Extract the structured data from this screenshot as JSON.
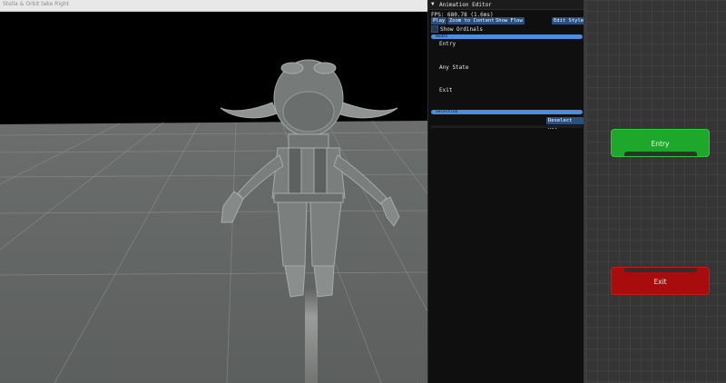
{
  "viewport": {
    "window_title": "Stella & Orbit take Right"
  },
  "editor": {
    "collapse_glyph": "▼",
    "title": "Animation Editor",
    "fps_text": "FPS: 680.78 (1.6ms)",
    "buttons": {
      "play": "Play",
      "zoom_to_content": "Zoom to Content",
      "show_flow": "Show Flow",
      "edit_style": "Edit Style"
    },
    "show_ordinals_label": "Show Ordinals",
    "show_ordinals_checked": false,
    "nodes_section": {
      "label": "Nodes",
      "items": [
        "Entry",
        "Any State",
        "Exit"
      ]
    },
    "selection_section": {
      "label": "Selection",
      "deselect_all_label": "Deselect All"
    }
  },
  "graph": {
    "nodes": [
      {
        "label": "Entry",
        "color": "#1ea82b"
      },
      {
        "label": "Exit",
        "color": "#a90c0c"
      }
    ],
    "background_color": "#353535"
  },
  "colors": {
    "accent": "#4c8de0",
    "button": "#2b4f7e"
  }
}
